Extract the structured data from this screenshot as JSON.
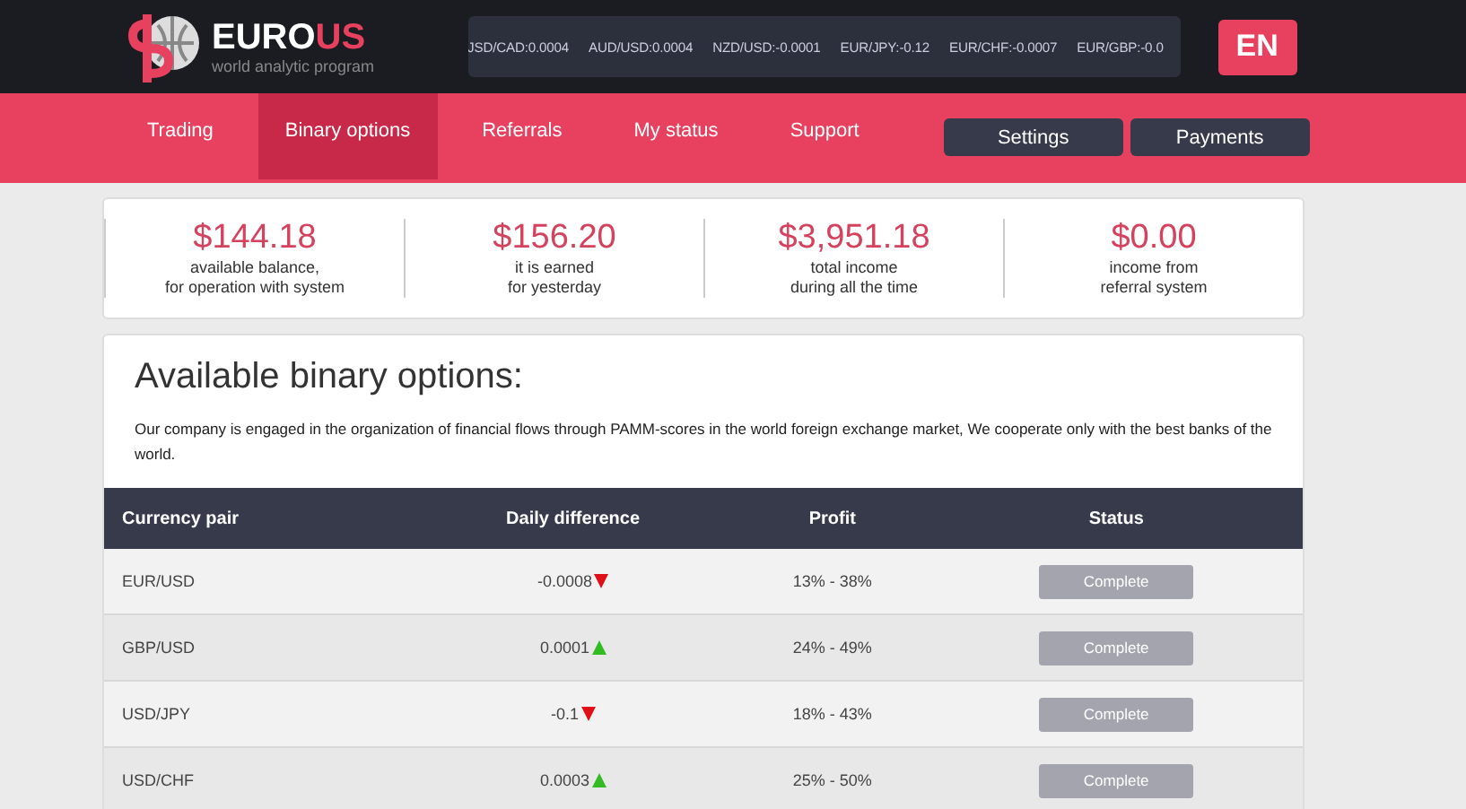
{
  "logo": {
    "name_part_1": "EURO",
    "name_part_2": "US",
    "tagline": "world analytic program"
  },
  "ticker": [
    "JSD/CAD:0.0004",
    "AUD/USD:0.0004",
    "NZD/USD:-0.0001",
    "EUR/JPY:-0.12",
    "EUR/CHF:-0.0007",
    "EUR/GBP:-0.0"
  ],
  "language": "EN",
  "nav": [
    {
      "label": "Trading",
      "selected": false
    },
    {
      "label": "Binary options",
      "selected": true
    },
    {
      "label": "Referrals",
      "selected": false
    },
    {
      "label": "My status",
      "selected": false
    },
    {
      "label": "Support",
      "selected": false
    }
  ],
  "nav_buttons": [
    "Settings",
    "Payments"
  ],
  "stats": [
    {
      "amount": "$144.18",
      "caption": [
        "available balance,",
        "for operation with system"
      ]
    },
    {
      "amount": "$156.20",
      "caption": [
        "it is earned",
        "for yesterday"
      ]
    },
    {
      "amount": "$3,951.18",
      "caption": [
        "total income",
        "during all the time"
      ]
    },
    {
      "amount": "$0.00",
      "caption": [
        "income from",
        "referral system"
      ]
    }
  ],
  "section": {
    "title": "Available binary options:",
    "description": "Our company is engaged in the organization of financial flows through PAMM-scores in the world foreign exchange market, We cooperate only with the best banks of the world."
  },
  "table": {
    "columns": [
      "Currency pair",
      "Daily difference",
      "Profit",
      "Status"
    ],
    "rows": [
      {
        "pair": "EUR/USD",
        "difference": "-0.0008",
        "kind": "down",
        "profit": "13% - 38%",
        "status": "Complete"
      },
      {
        "pair": "GBP/USD",
        "difference": "0.0001",
        "kind": "up",
        "profit": "24% - 49%",
        "status": "Complete"
      },
      {
        "pair": "USD/JPY",
        "difference": "-0.1",
        "kind": "down",
        "profit": "18% - 43%",
        "status": "Complete"
      },
      {
        "pair": "USD/CHF",
        "difference": "0.0003",
        "kind": "up",
        "profit": "25% - 50%",
        "status": "Complete"
      }
    ]
  }
}
